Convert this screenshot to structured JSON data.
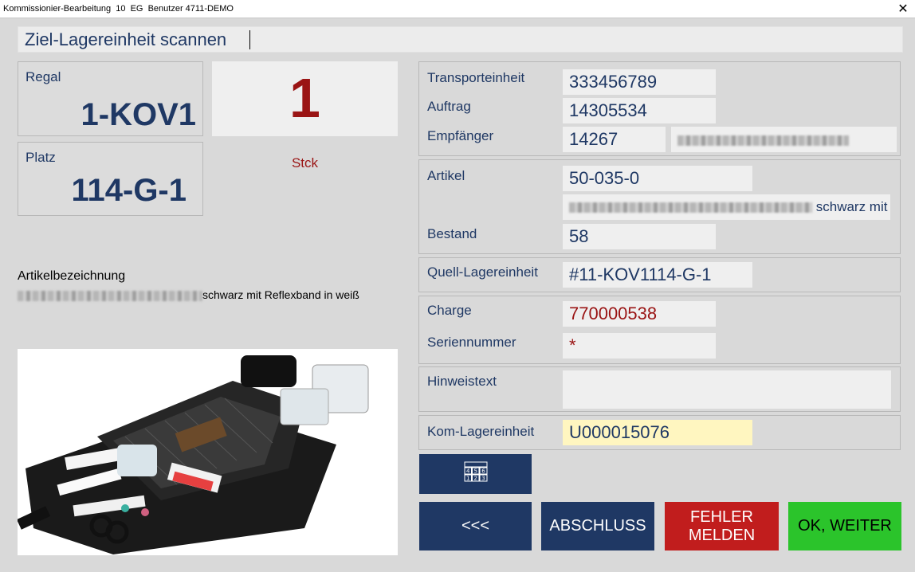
{
  "window": {
    "title": "Kommissionier-Bearbeitung  10  EG  Benutzer 4711-DEMO",
    "close_glyph": "✕"
  },
  "scan": {
    "prompt": "Ziel-Lagereinheit scannen"
  },
  "location": {
    "regal_label": "Regal",
    "regal_value": "1-KOV1",
    "platz_label": "Platz",
    "platz_value": "114-G-1"
  },
  "quantity": {
    "value": "1",
    "unit": "Stck"
  },
  "article_description": {
    "heading": "Artikelbezeichnung",
    "visible_text": "schwarz mit Reflexband in weiß"
  },
  "details": {
    "transport_label": "Transporteinheit",
    "transport_value": "333456789",
    "auftrag_label": "Auftrag",
    "auftrag_value": "14305534",
    "empfaenger_label": "Empfänger",
    "empfaenger_value": "14267",
    "artikel_label": "Artikel",
    "artikel_value": "50-035-0",
    "artikel_desc_visible": "schwarz mit",
    "bestand_label": "Bestand",
    "bestand_value": "58",
    "quell_label": "Quell-Lagereinheit",
    "quell_value": "#11-KOV1114-G-1",
    "charge_label": "Charge",
    "charge_value": "770000538",
    "serien_label": "Seriennummer",
    "serien_value": "*",
    "hinweis_label": "Hinweistext",
    "hinweis_value": "",
    "kom_label": "Kom-Lagereinheit",
    "kom_value": "U000015076"
  },
  "buttons": {
    "keypad_digits": [
      "4",
      "5",
      "6",
      "1",
      "2",
      "3"
    ],
    "back": "<<<",
    "abschluss": "ABSCHLUSS",
    "fehler": "FEHLER\nMELDEN",
    "ok": "OK, WEITER"
  },
  "colors": {
    "navy": "#1f3864",
    "red_text": "#9a1414",
    "error_button": "#c11d1d",
    "ok_button": "#2bc42b",
    "highlight_field": "#fff6c0"
  }
}
